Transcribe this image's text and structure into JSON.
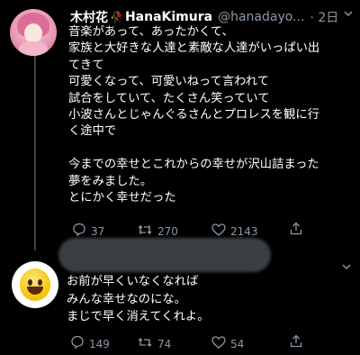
{
  "tweet": {
    "display_name": "木村花",
    "rose_icon": "rose-emoji",
    "display_name_suffix": "HanaKimura",
    "handle": "@hanadayo...",
    "time": "· 2日",
    "lines": [
      "音楽があって、あったかくて、",
      "家族と大好きな人達と素敵な人達がいっぱい出",
      "てきて",
      "可愛くなって、可愛いねって言われて",
      "試合をしていて、たくさん笑っていて",
      "小波さんとじゃんぐるさんとプロレスを観に行",
      "く途中で",
      "",
      "今までの幸せとこれからの幸せが沢山詰まった",
      "夢をみました。",
      "とにかく幸せだった"
    ],
    "replies": "37",
    "retweets": "270",
    "likes": "2143"
  },
  "reply": {
    "lines": [
      "お前が早くいなくなれば",
      "みんな幸せなのにな。",
      "まじで早く消えてくれよ。"
    ],
    "replies": "149",
    "retweets": "74",
    "likes": "54"
  },
  "colors": {
    "background": "#000000",
    "text": "#ffffff",
    "secondary": "#8b98a5"
  }
}
